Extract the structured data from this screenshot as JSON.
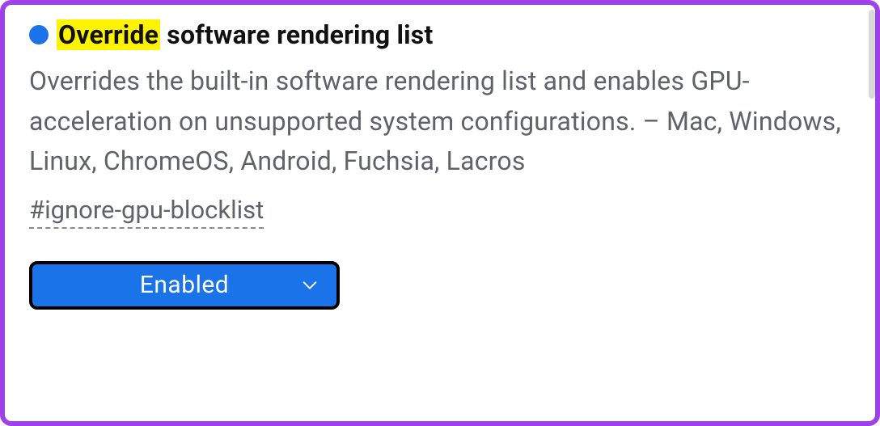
{
  "flag": {
    "dot_color": "#1a73e8",
    "title_highlight": "Override",
    "title_rest": " software rendering list",
    "description": "Overrides the built-in software rendering list and enables GPU-acceleration on unsupported system configurations. – Mac, Windows, Linux, ChromeOS, Android, Fuchsia, Lacros",
    "anchor": "#ignore-gpu-blocklist",
    "select": {
      "value": "Enabled"
    }
  },
  "colors": {
    "frame": "#a040e8",
    "accent": "#1a73e8",
    "highlight": "#fff400"
  }
}
